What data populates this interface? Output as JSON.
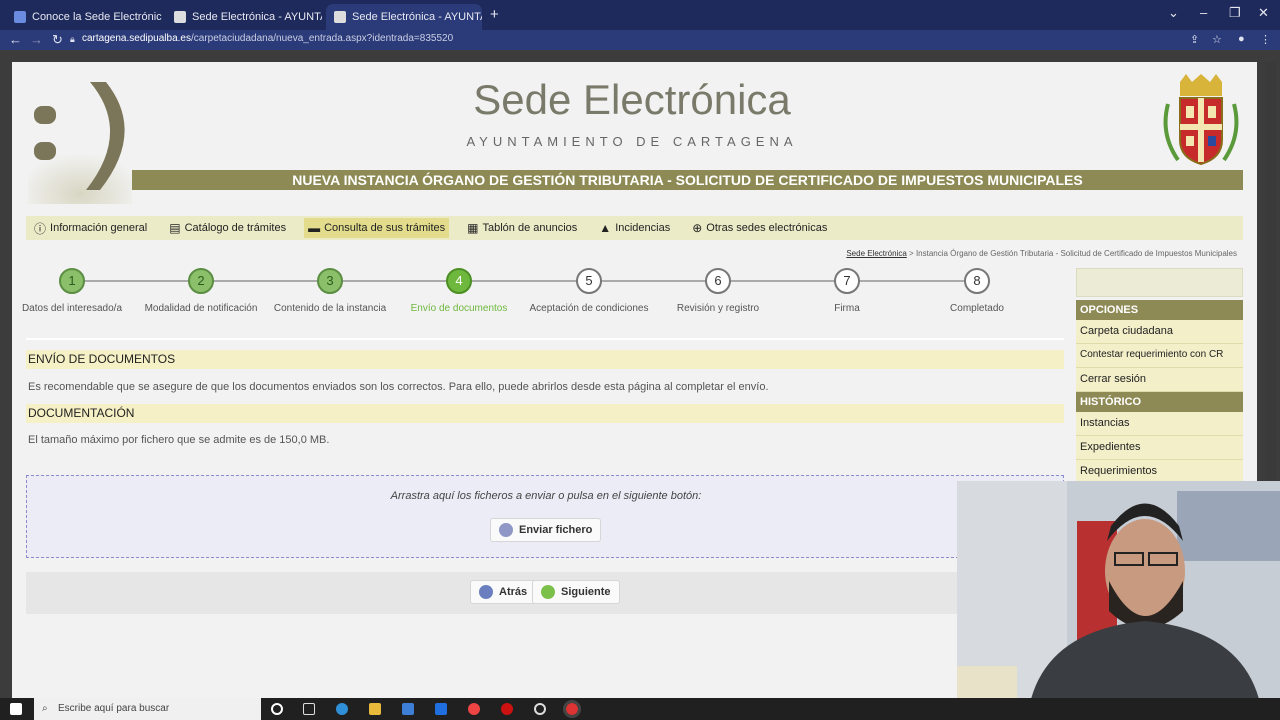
{
  "browser": {
    "tabs": [
      {
        "title": "Conoce la Sede Electrónica | Inf"
      },
      {
        "title": "Sede Electrónica - AYUNTAMIEN"
      },
      {
        "title": "Sede Electrónica - AYUNTAMIEN"
      }
    ],
    "url_domain": "cartagena.sedipualba.es",
    "url_path": "/carpetaciudadana/nueva_entrada.aspx?identrada=835520"
  },
  "header": {
    "site_title": "Sede Electrónica",
    "subtitle": "AYUNTAMIENTO DE CARTAGENA",
    "procedure_title": "NUEVA INSTANCIA ÓRGANO DE GESTIÓN TRIBUTARIA - SOLICITUD DE CERTIFICADO DE IMPUESTOS MUNICIPALES"
  },
  "menu": [
    {
      "label": "Información general",
      "icon": "info-icon"
    },
    {
      "label": "Catálogo de trámites",
      "icon": "document-icon"
    },
    {
      "label": "Consulta de sus trámites",
      "icon": "folder-icon"
    },
    {
      "label": "Tablón de anuncios",
      "icon": "board-icon"
    },
    {
      "label": "Incidencias",
      "icon": "warning-icon"
    },
    {
      "label": "Otras sedes electrónicas",
      "icon": "globe-icon"
    }
  ],
  "breadcrumb": {
    "home": "Sede Electrónica",
    "rest": "> Instancia Órgano de Gestión Tributaria - Solicitud de Certificado de Impuestos Municipales"
  },
  "steps": [
    {
      "num": "1",
      "label": "Datos del interesado/a"
    },
    {
      "num": "2",
      "label": "Modalidad de notificación"
    },
    {
      "num": "3",
      "label": "Contenido de la instancia"
    },
    {
      "num": "4",
      "label": "Envío de documentos"
    },
    {
      "num": "5",
      "label": "Aceptación de condiciones"
    },
    {
      "num": "6",
      "label": "Revisión y registro"
    },
    {
      "num": "7",
      "label": "Firma"
    },
    {
      "num": "8",
      "label": "Completado"
    }
  ],
  "current_step": 4,
  "main": {
    "section1_title": "ENVÍO DE DOCUMENTOS",
    "section1_text": "Es recomendable que se asegure de que los documentos enviados son los correctos. Para ello, puede abrirlos desde esta página al completar el envío.",
    "section2_title": "DOCUMENTACIÓN",
    "section2_text": "El tamaño máximo por fichero que se admite es de 150,0 MB.",
    "drop_text": "Arrastra aquí los ficheros a enviar o pulsa en el siguiente botón:",
    "send_button": "Enviar fichero",
    "back_button": "Atrás",
    "next_button": "Siguiente"
  },
  "sidebar": {
    "opciones_title": "OPCIONES",
    "opciones": [
      "Carpeta ciudadana",
      "Contestar requerimiento con CR",
      "Cerrar sesión"
    ],
    "historico_title": "HISTÓRICO",
    "historico": [
      "Instancias",
      "Expedientes",
      "Requerimientos"
    ]
  },
  "taskbar": {
    "search_placeholder": "Escribe aquí para buscar"
  },
  "colors": {
    "brand_olive": "#8e8a55",
    "step_done": "#8bbf6a",
    "step_current": "#6fb83e",
    "browser_blue": "#1f2a5c"
  }
}
